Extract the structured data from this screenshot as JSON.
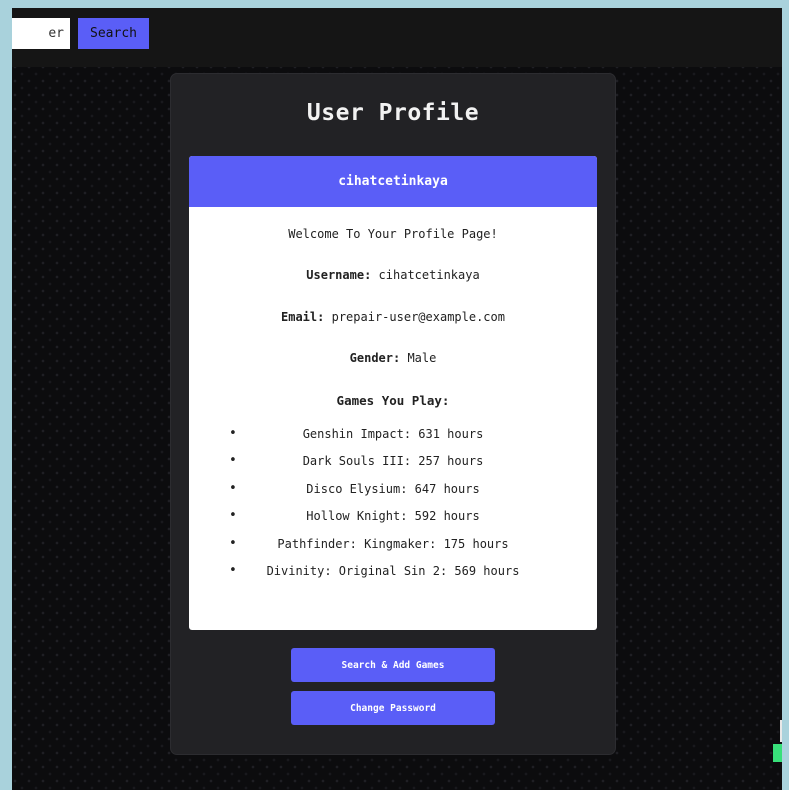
{
  "topbar": {
    "search_value": "er",
    "search_button_label": "Search"
  },
  "card": {
    "title": "User Profile"
  },
  "profile": {
    "header_username": "cihatcetinkaya",
    "welcome": "Welcome To Your Profile Page!",
    "username_label": "Username:",
    "username_value": "cihatcetinkaya",
    "email_label": "Email:",
    "email_value": "prepair-user@example.com",
    "gender_label": "Gender:",
    "gender_value": "Male",
    "games_heading": "Games You Play:",
    "games": [
      "Genshin Impact: 631 hours",
      "Dark Souls III: 257 hours",
      "Disco Elysium: 647 hours",
      "Hollow Knight: 592 hours",
      "Pathfinder: Kingmaker: 175 hours",
      "Divinity: Original Sin 2: 569 hours"
    ]
  },
  "actions": {
    "search_add_label": "Search & Add Games",
    "change_password_label": "Change Password"
  },
  "colors": {
    "accent": "#5a5ef7",
    "page_bg": "#0c0c0e",
    "card_bg": "#222225",
    "outer_bg": "#a9d2dc"
  }
}
